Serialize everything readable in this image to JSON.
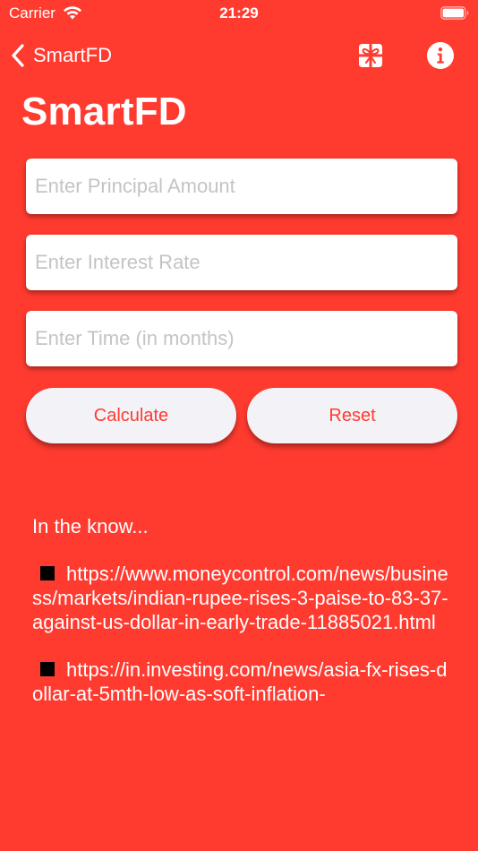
{
  "status_bar": {
    "carrier": "Carrier",
    "time": "21:29",
    "icons": [
      "wifi-icon",
      "battery-icon"
    ]
  },
  "nav": {
    "back_label": "SmartFD",
    "back_icon": "chevron-left-icon",
    "right_icons": [
      "gift-icon",
      "info-icon"
    ]
  },
  "title": "SmartFD",
  "form": {
    "principal_placeholder": "Enter Principal Amount",
    "principal_value": "",
    "rate_placeholder": "Enter Interest Rate",
    "rate_value": "",
    "time_placeholder": "Enter Time (in months)",
    "time_value": ""
  },
  "buttons": {
    "calculate": "Calculate",
    "reset": "Reset"
  },
  "news": {
    "heading": "In the know...",
    "items": [
      "https://www.moneycontrol.com/news/business/markets/indian-rupee-rises-3-paise-to-83-37-against-us-dollar-in-early-trade-11885021.html",
      "https://in.investing.com/news/asia-fx-rises-dollar-at-5mth-low-as-soft-inflation-"
    ]
  },
  "colors": {
    "background": "#ff3b30",
    "button_bg": "#f2f2f7",
    "button_text": "#ff3b30",
    "field_bg": "#ffffff",
    "placeholder": "#c4c4c8"
  }
}
